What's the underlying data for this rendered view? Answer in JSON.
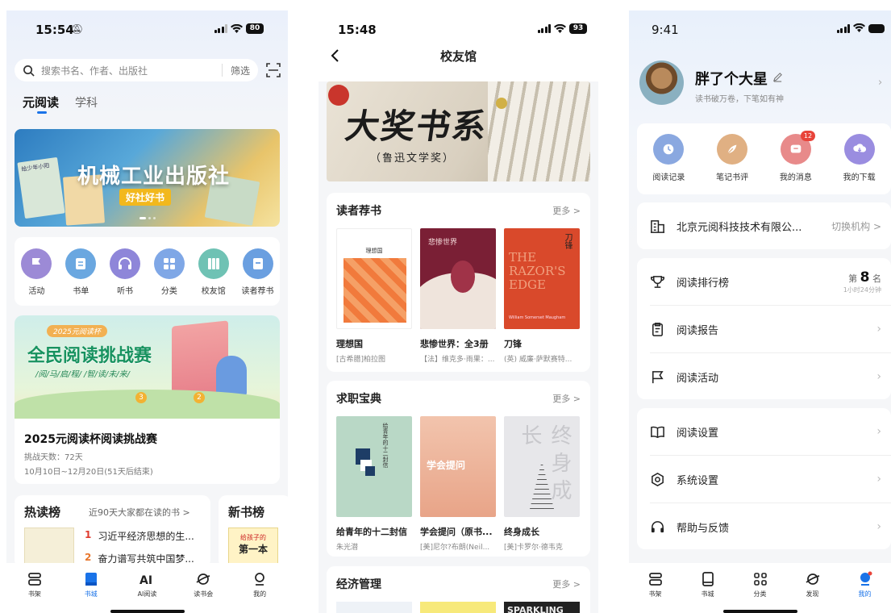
{
  "phone1": {
    "time": "15:54",
    "battery": "80",
    "search_placeholder": "搜索书名、作者、出版社",
    "search_filter": "筛选",
    "top_tabs": [
      "元阅读",
      "学科"
    ],
    "banner": {
      "title": "机械工业出版社",
      "tag": "好社好书",
      "book_label": "给少年小阳"
    },
    "icons": [
      {
        "label": "活动",
        "icon": "flag-icon",
        "color": "#9c8ad6"
      },
      {
        "label": "书单",
        "icon": "list-icon",
        "color": "#6aa7e0"
      },
      {
        "label": "听书",
        "icon": "headphones-icon",
        "color": "#8e86d9"
      },
      {
        "label": "分类",
        "icon": "grid-icon",
        "color": "#7fa7e6"
      },
      {
        "label": "校友馆",
        "icon": "books-icon",
        "color": "#6fc2b4"
      },
      {
        "label": "读者荐书",
        "icon": "bookmark-icon",
        "color": "#6a9fe0"
      }
    ],
    "challenge": {
      "badge": "2025元阅读杯",
      "headline": "全民阅读挑战赛",
      "slogan": "/阅/马/启/程/ /智/读/未/来/",
      "title": "2025元阅读杯阅读挑战赛",
      "days": "挑战天数：72天",
      "period": "10月10日~12月20日(51天后结束)",
      "marker1": "1",
      "marker2": "2",
      "marker3": "3"
    },
    "hot": {
      "title": "热读榜",
      "subtitle": "近90天大家都在读的书 >",
      "items": [
        {
          "rank": "1",
          "text": "习近平经济思想的生..."
        },
        {
          "rank": "2",
          "text": "奋力谱写共筑中国梦..."
        }
      ]
    },
    "new_books": {
      "title": "新书榜",
      "cover_text": "第一本",
      "cover_sub": "给孩子的"
    },
    "tabbar": [
      "书架",
      "书城",
      "AI阅读",
      "读书会",
      "我的"
    ]
  },
  "phone2": {
    "time": "15:48",
    "battery": "93",
    "title": "校友馆",
    "banner": {
      "title": "大奖书系",
      "subtitle": "（鲁迅文学奖）"
    },
    "sections": [
      {
        "title": "读者荐书",
        "more": "更多 >",
        "books": [
          {
            "title": "理想国",
            "author": "[古希腊]柏拉图",
            "cover_text": "理想国"
          },
          {
            "title": "悲惨世界：全3册",
            "author": "【法】维克多·雨果：...",
            "cover_text": "悲惨世界"
          },
          {
            "title": "刀锋",
            "author": "(英) 威廉·萨默赛特...",
            "cover_text": "刀锋",
            "cover_en": "THE RAZOR'S EDGE",
            "cover_author": "William Somerset Maugham"
          }
        ]
      },
      {
        "title": "求职宝典",
        "more": "更多 >",
        "books": [
          {
            "title": "给青年的十二封信",
            "author": "朱光潜",
            "cover_text": "给青年的十二封信"
          },
          {
            "title": "学会提问（原书...",
            "author": "[美]尼尔?布朗(Neil...",
            "cover_text": "学会提问"
          },
          {
            "title": "终身成长",
            "author": "[美]卡罗尔·德韦克",
            "cover_text": "终身成长"
          }
        ]
      },
      {
        "title": "经济管理",
        "more": "更多 >",
        "cover_text": "SPARKLING"
      }
    ]
  },
  "phone3": {
    "time": "9:41",
    "profile": {
      "name": "胖了个大星",
      "motto": "读书破万卷，下笔如有神"
    },
    "quick": [
      {
        "label": "阅读记录",
        "icon": "clock-icon",
        "color": "#8aa8e0"
      },
      {
        "label": "笔记书评",
        "icon": "feather-icon",
        "color": "#e0b083"
      },
      {
        "label": "我的消息",
        "icon": "message-icon",
        "color": "#e88a8a",
        "badge": "12"
      },
      {
        "label": "我的下载",
        "icon": "download-icon",
        "color": "#9a8de0"
      }
    ],
    "org": {
      "name": "北京元阅科技技术有限公...",
      "switch": "切换机构 >"
    },
    "rank": {
      "label": "阅读排行榜",
      "prefix": "第",
      "value": "8",
      "suffix": "名",
      "time": "1小时24分钟"
    },
    "menu1": [
      "阅读报告",
      "阅读活动"
    ],
    "menu2": [
      "阅读设置",
      "系统设置",
      "帮助与反馈"
    ],
    "tabbar": [
      "书架",
      "书城",
      "分类",
      "发现",
      "我的"
    ]
  }
}
